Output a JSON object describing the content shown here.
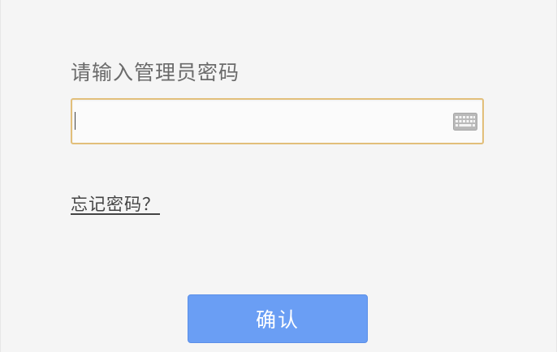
{
  "login": {
    "prompt": "请输入管理员密码",
    "password_value": "",
    "password_placeholder": "",
    "forgot_link": "忘记密码？",
    "confirm_label": "确认"
  },
  "icons": {
    "keyboard": "keyboard-icon"
  },
  "colors": {
    "background": "#f5f5f5",
    "input_border": "#e2bf7a",
    "button_bg": "#6a9ef4",
    "button_text": "#ffffff",
    "prompt_text": "#6b6b6b"
  }
}
